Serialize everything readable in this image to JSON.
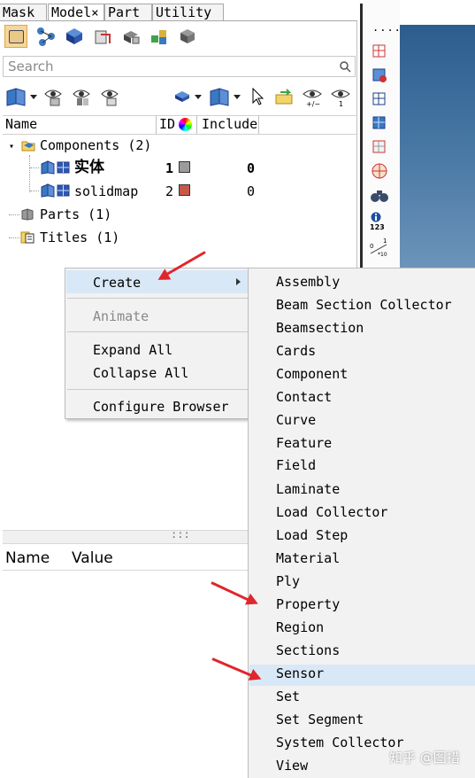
{
  "tabs": [
    {
      "label": "Mask"
    },
    {
      "label": "Model"
    },
    {
      "label": "Part"
    },
    {
      "label": "Utility"
    }
  ],
  "tab_close_glyph": "×",
  "search": {
    "placeholder": "Search"
  },
  "columns": {
    "name": "Name",
    "id": "ID",
    "include": "Include"
  },
  "tree": {
    "components": {
      "label": "Components (2)"
    },
    "rows": [
      {
        "name": "实体",
        "id": "1",
        "include": "0",
        "color": "#9b9b9b"
      },
      {
        "name": "solidmap",
        "id": "2",
        "include": "0",
        "color": "#c6584a"
      }
    ],
    "parts": {
      "label": "Parts (1)"
    },
    "titles": {
      "label": "Titles (1)"
    }
  },
  "splitter_grip": ":::",
  "props_header": {
    "name": "Name",
    "value": "Value"
  },
  "context_menu": {
    "create": "Create",
    "animate": "Animate",
    "expand_all": "Expand All",
    "collapse_all": "Collapse All",
    "configure": "Configure Browser"
  },
  "submenu": [
    "Assembly",
    "Beam Section Collector",
    "Beamsection",
    "Cards",
    "Component",
    "Contact",
    "Curve",
    "Feature",
    "Field",
    "Laminate",
    "Load Collector",
    "Load Step",
    "Material",
    "Ply",
    "Property",
    "Region",
    "Sections",
    "Sensor",
    "Set",
    "Set Segment",
    "System Collector",
    "View"
  ],
  "submenu_highlight": "Sensor",
  "right_toolbar": {
    "dots": "....",
    "label_123": "123"
  },
  "watermark": "知乎 @图措",
  "colors": {
    "accent_arrow": "#e0262b",
    "hover": "#d9e8f7",
    "viewport": "#3f6d99"
  }
}
